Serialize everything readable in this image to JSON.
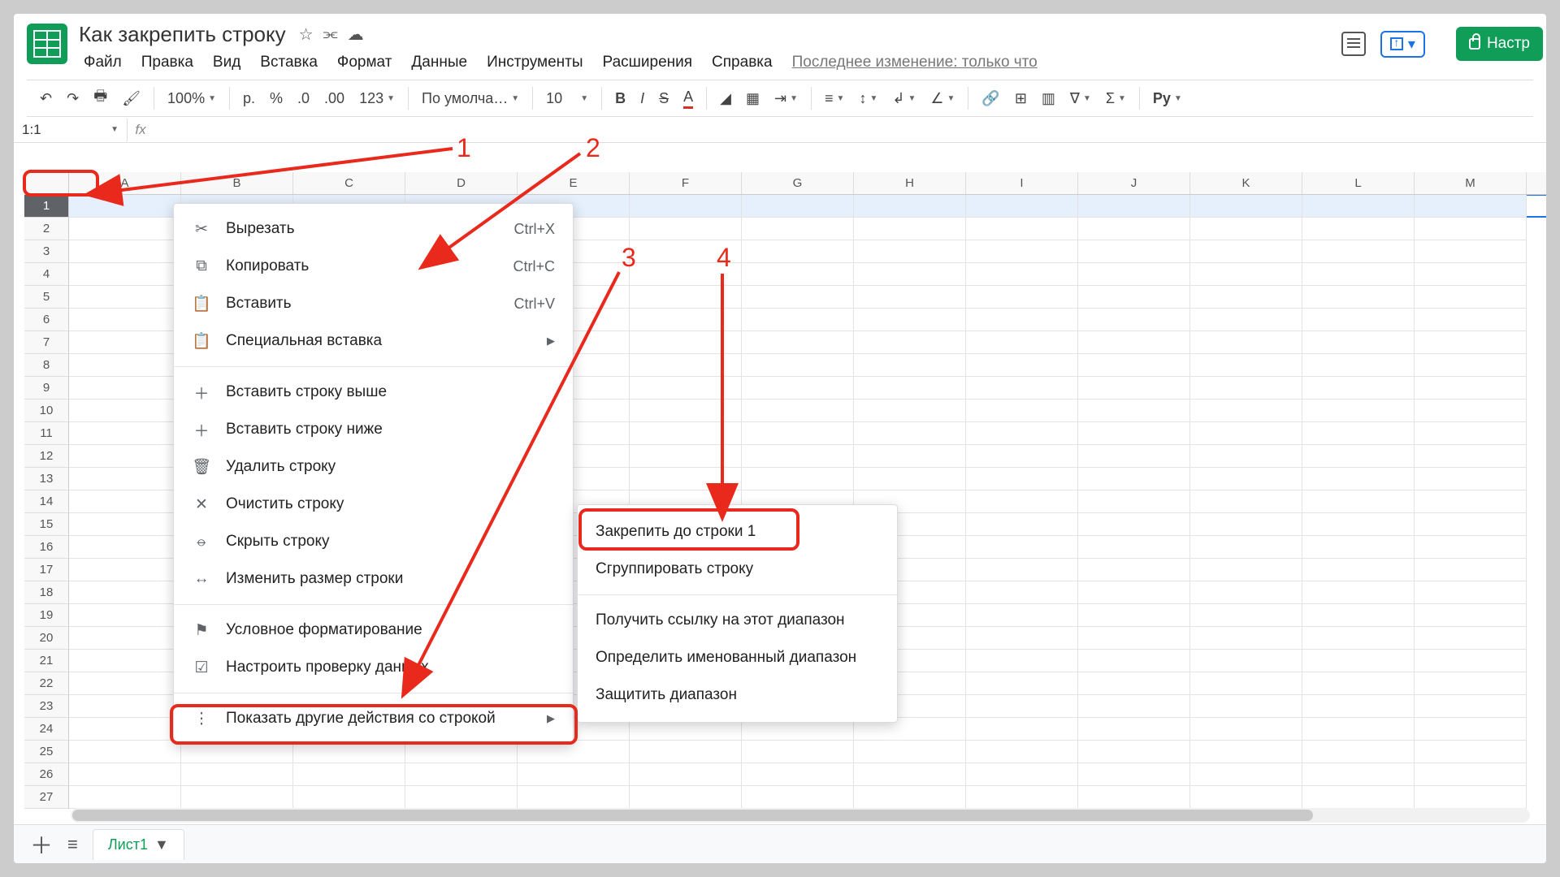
{
  "doc_title": "Как закрепить строку",
  "last_edit": "Последнее изменение: только что",
  "settings_label": "Настр",
  "menus": [
    "Файл",
    "Правка",
    "Вид",
    "Вставка",
    "Формат",
    "Данные",
    "Инструменты",
    "Расширения",
    "Справка"
  ],
  "toolbar": {
    "zoom": "100%",
    "currency": "р.",
    "percent": "%",
    "dec_dec": ".0",
    "inc_dec": ".00",
    "fmt": "123",
    "font": "По умолча…",
    "size": "10",
    "py": "Py"
  },
  "name_box": "1:1",
  "fx_label": "fx",
  "columns": [
    "A",
    "B",
    "C",
    "D",
    "E",
    "F",
    "G",
    "H",
    "I",
    "J",
    "K",
    "L",
    "M"
  ],
  "row_count": 27,
  "context_menu": [
    {
      "icon": "✂",
      "label": "Вырезать",
      "shortcut": "Ctrl+X"
    },
    {
      "icon": "⧉",
      "label": "Копировать",
      "shortcut": "Ctrl+C"
    },
    {
      "icon": "📋",
      "label": "Вставить",
      "shortcut": "Ctrl+V"
    },
    {
      "icon": "📋",
      "label": "Специальная вставка",
      "submenu": true
    },
    {
      "divider": true
    },
    {
      "icon": "＋",
      "label": "Вставить строку выше"
    },
    {
      "icon": "＋",
      "label": "Вставить строку ниже"
    },
    {
      "icon": "🗑",
      "label": "Удалить строку"
    },
    {
      "icon": "✕",
      "label": "Очистить строку"
    },
    {
      "icon": "⦵",
      "label": "Скрыть строку"
    },
    {
      "icon": "↔",
      "label": "Изменить размер строки"
    },
    {
      "divider": true
    },
    {
      "icon": "⚑",
      "label": "Условное форматирование"
    },
    {
      "icon": "☑",
      "label": "Настроить проверку данных"
    },
    {
      "divider": true
    },
    {
      "icon": "⋮",
      "label": "Показать другие действия со строкой",
      "submenu": true,
      "highlight": true
    }
  ],
  "submenu": [
    {
      "label": "Закрепить до строки 1",
      "highlight": true
    },
    {
      "label": "Сгруппировать строку"
    },
    {
      "divider": true
    },
    {
      "label": "Получить ссылку на этот диапазон"
    },
    {
      "label": "Определить именованный диапазон"
    },
    {
      "label": "Защитить диапазон"
    }
  ],
  "annotations": {
    "n1": "1",
    "n2": "2",
    "n3": "3",
    "n4": "4"
  },
  "sheet_tab": "Лист1"
}
